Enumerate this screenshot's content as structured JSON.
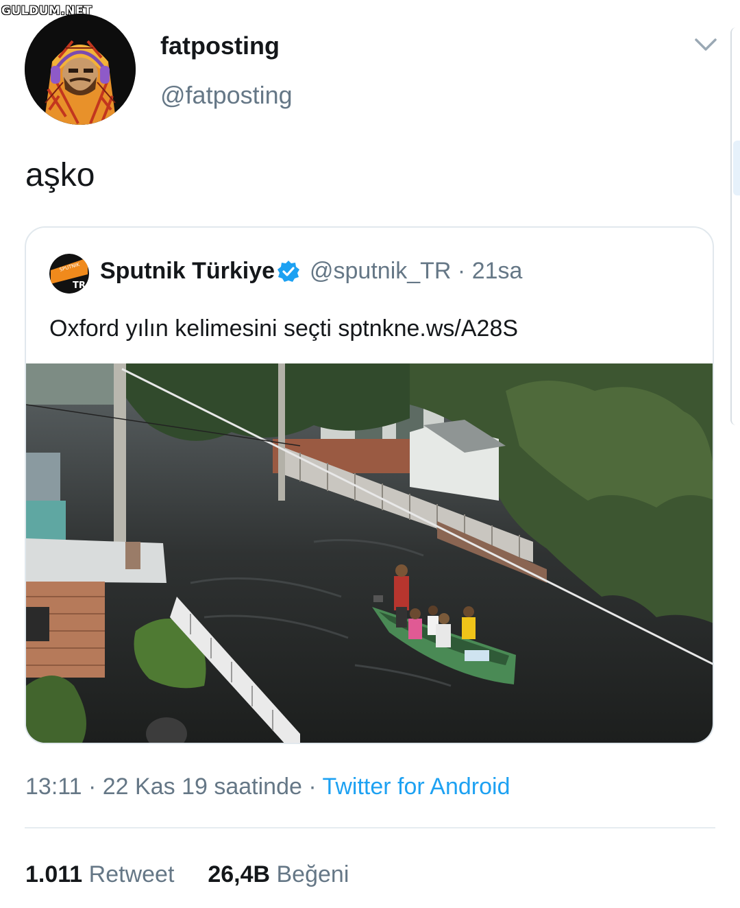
{
  "watermark": "GULDUM.NET",
  "author": {
    "display_name": "fatposting",
    "handle": "@fatposting",
    "avatar_icon": "user-avatar-headphones"
  },
  "tweet": {
    "text": "aşko"
  },
  "quoted": {
    "name": "Sputnik Türkiye",
    "verified_icon": "verified-badge-icon",
    "avatar_text": "SPUTNIK",
    "avatar_badge": "TR",
    "meta": "@sputnik_TR · 21sa",
    "text": "Oxford yılın kelimesini seçti sptnkne.ws/A28S",
    "photo": "flooded-street-boat-photo"
  },
  "timestamp": {
    "time": "13:11 · 22 Kas 19 saatinde · ",
    "source": "Twitter for Android"
  },
  "stats": {
    "retweets": "1.011",
    "retweets_label": "Retweet",
    "likes": "26,4B",
    "likes_label": "Beğeni"
  },
  "colors": {
    "link": "#1da1f2",
    "secondary": "#657786",
    "verified": "#1da1f2"
  }
}
